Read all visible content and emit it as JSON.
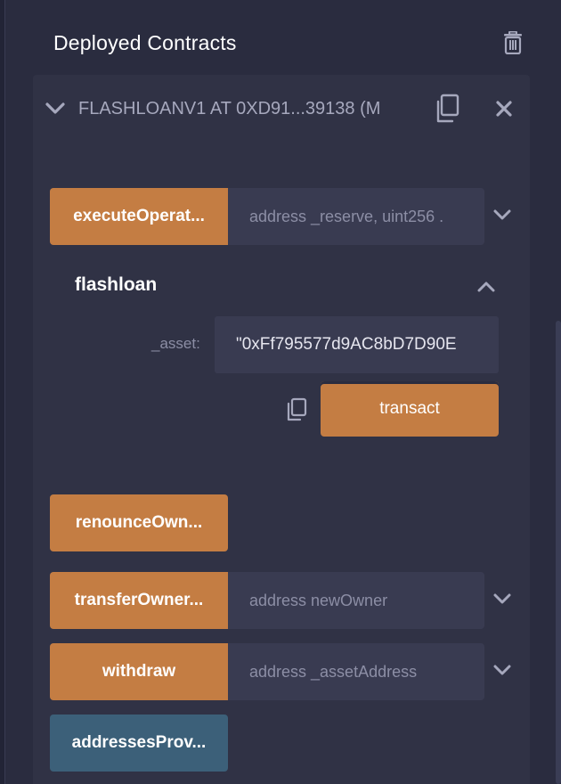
{
  "header": {
    "title": "Deployed Contracts"
  },
  "contract": {
    "name": "FLASHLOANV1 AT 0XD91...39138 (M"
  },
  "functions": {
    "execute_operation": {
      "label": "executeOperat...",
      "placeholder": "address _reserve, uint256 ."
    },
    "flashloan": {
      "title": "flashloan",
      "param_label": "_asset:",
      "param_value": "\"0xFf795577d9AC8bD7D90E",
      "transact_label": "transact"
    },
    "renounce_ownership": {
      "label": "renounceOwn..."
    },
    "transfer_ownership": {
      "label": "transferOwner...",
      "placeholder": "address newOwner"
    },
    "withdraw": {
      "label": "withdraw",
      "placeholder": "address _assetAddress"
    },
    "addresses_provider": {
      "label": "addressesProv..."
    }
  },
  "icons": {
    "trash": "trash-icon",
    "copy": "copy-icon",
    "close": "close-icon",
    "chevron_down": "chevron-down-icon",
    "chevron_up": "chevron-up-icon"
  },
  "colors": {
    "background": "#2a2c3f",
    "panel": "#303245",
    "input": "#393b51",
    "action_orange": "#c47d43",
    "call_blue": "#3c6079"
  }
}
